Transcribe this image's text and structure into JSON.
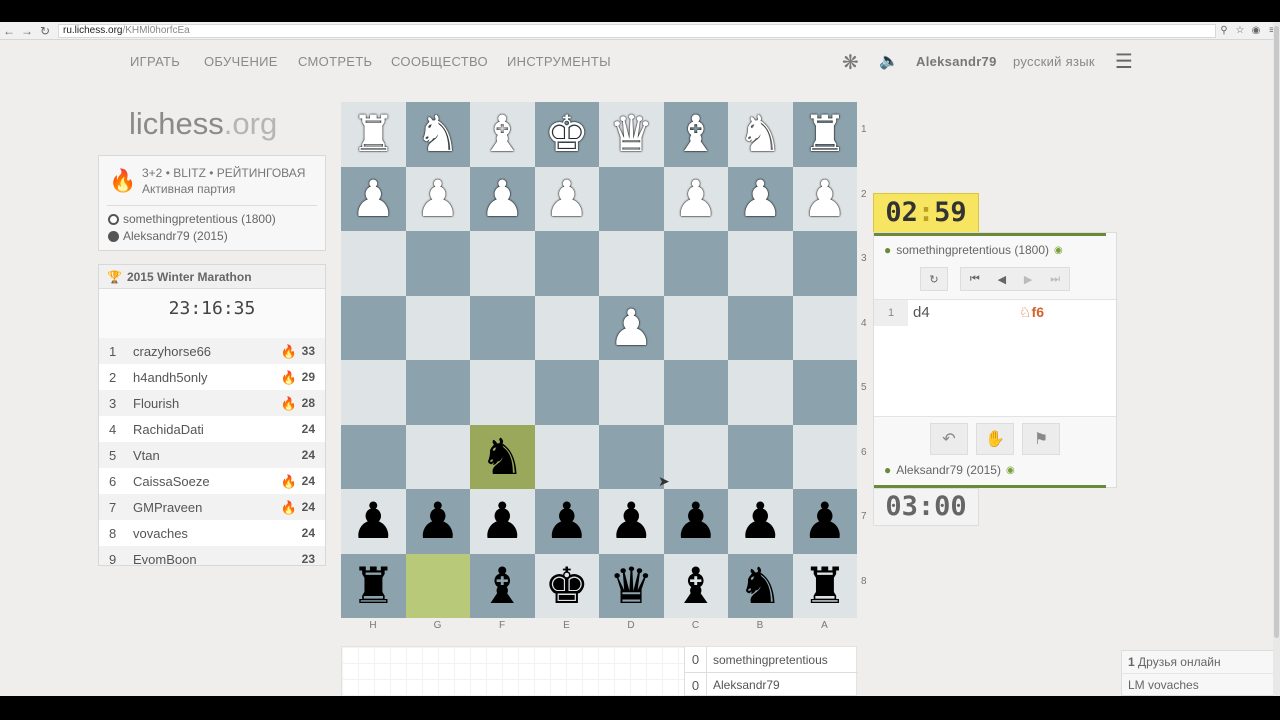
{
  "browser": {
    "url_host": "ru.lichess.org",
    "url_path": "/KHMl0horfcEa",
    "back_icon": "arrow-left-icon",
    "forward_icon": "arrow-right-icon",
    "reload_icon": "reload-icon"
  },
  "nav": {
    "items": [
      "ИГРАТЬ",
      "ОБУЧЕНИЕ",
      "СМОТРЕТЬ",
      "СООБЩЕСТВО",
      "ИНСТРУМЕНТЫ"
    ],
    "username": "Aleksandr79",
    "language": "русский язык"
  },
  "logo": {
    "main": "lichess",
    "suffix": ".org"
  },
  "game": {
    "mode": "3+2 • BLITZ • РЕЙТИНГОВАЯ",
    "status": "Активная партия",
    "white_player": "somethingpretentious (1800)",
    "black_player": "Aleksandr79 (2015)"
  },
  "tournament": {
    "title": "2015 Winter Marathon",
    "clock": "23:16:35",
    "rows": [
      {
        "rank": "1",
        "name": "crazyhorse66",
        "score": "33",
        "fire": true
      },
      {
        "rank": "2",
        "name": "h4andh5only",
        "score": "29",
        "fire": true
      },
      {
        "rank": "3",
        "name": "Flourish",
        "score": "28",
        "fire": true
      },
      {
        "rank": "4",
        "name": "RachidaDati",
        "score": "24",
        "fire": false
      },
      {
        "rank": "5",
        "name": "Vtan",
        "score": "24",
        "fire": false
      },
      {
        "rank": "6",
        "name": "CaissaSoeze",
        "score": "24",
        "fire": true
      },
      {
        "rank": "7",
        "name": "GMPraveen",
        "score": "24",
        "fire": true
      },
      {
        "rank": "8",
        "name": "vovaches",
        "score": "24",
        "fire": false
      },
      {
        "rank": "9",
        "name": "EvomBoon",
        "score": "23",
        "fire": false
      }
    ]
  },
  "board": {
    "ranks": [
      "1",
      "2",
      "3",
      "4",
      "5",
      "6",
      "7",
      "8"
    ],
    "files": [
      "H",
      "G",
      "F",
      "E",
      "D",
      "C",
      "B",
      "A"
    ],
    "rows": [
      [
        "wR",
        "wN",
        "wB",
        "wK",
        "wQ",
        "wB",
        "wN",
        "wR"
      ],
      [
        "wP",
        "wP",
        "wP",
        "wP",
        "",
        "wP",
        "wP",
        "wP"
      ],
      [
        "",
        "",
        "",
        "",
        "",
        "",
        "",
        ""
      ],
      [
        "",
        "",
        "",
        "",
        "wP",
        "",
        "",
        ""
      ],
      [
        "",
        "",
        "",
        "",
        "",
        "",
        "",
        ""
      ],
      [
        "",
        "",
        "bN",
        "",
        "",
        "",
        "",
        ""
      ],
      [
        "bP",
        "bP",
        "bP",
        "bP",
        "bP",
        "bP",
        "bP",
        "bP"
      ],
      [
        "bR",
        "",
        "bB",
        "bK",
        "bQ",
        "bB",
        "bN",
        "bR"
      ]
    ],
    "highlight_from": [
      7,
      1
    ],
    "highlight_to": [
      5,
      2
    ]
  },
  "clocks": {
    "opponent_min": "02",
    "opponent_sec": "59",
    "player": "03:00"
  },
  "panel": {
    "top_player": "somethingpretentious (1800)",
    "bottom_player": "Aleksandr79 (2015)",
    "move_number": "1",
    "white_move": "d4",
    "black_move": "♘f6"
  },
  "crosstable": [
    {
      "score": "0",
      "name": "somethingpretentious"
    },
    {
      "score": "0",
      "name": "Aleksandr79"
    }
  ],
  "friends": {
    "count_line_num": "1",
    "count_line_text": "Друзья онлайн",
    "friend": "LM vovaches"
  }
}
